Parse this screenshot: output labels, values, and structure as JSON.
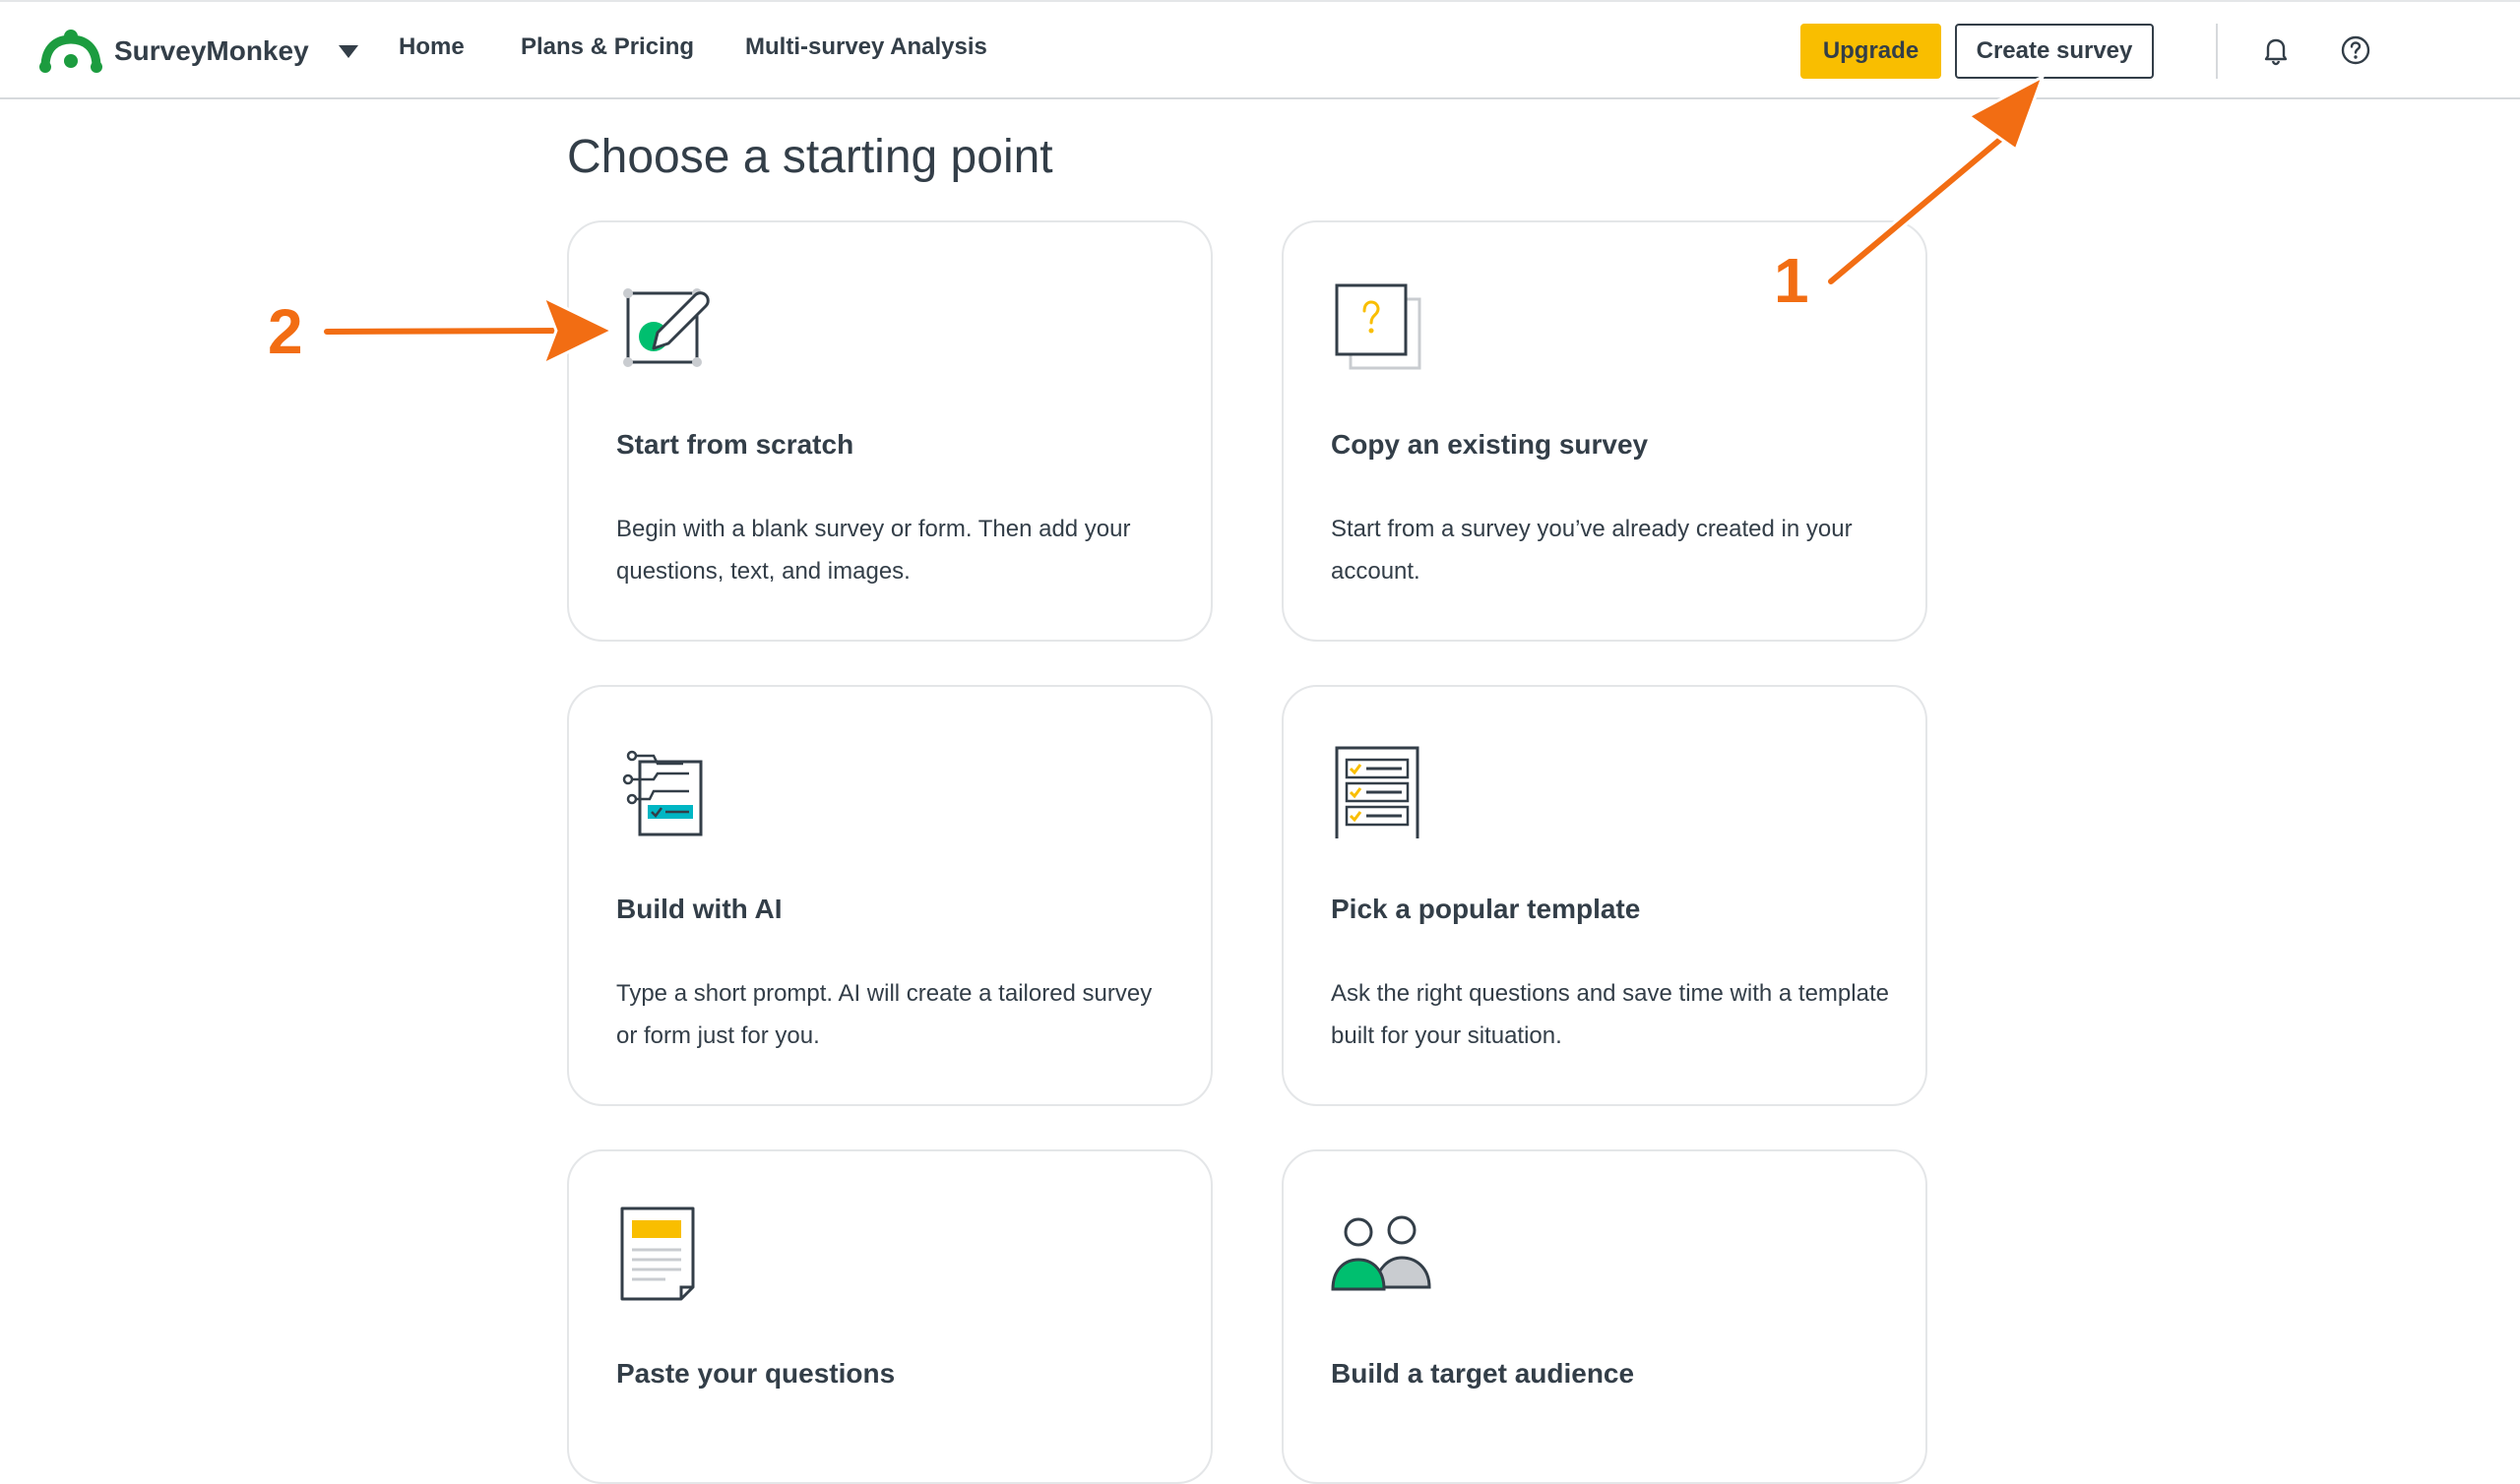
{
  "header": {
    "brand": "SurveyMonkey",
    "nav": [
      {
        "label": "Home"
      },
      {
        "label": "Plans & Pricing"
      },
      {
        "label": "Multi-survey Analysis"
      }
    ],
    "upgrade_label": "Upgrade",
    "create_label": "Create survey",
    "icons": [
      "bell-icon",
      "help-icon"
    ]
  },
  "main": {
    "title": "Choose a starting point",
    "cards": [
      {
        "title": "Start from scratch",
        "desc": "Begin with a blank survey or form. Then add your questions, text, and images.",
        "icon": "pencil-edit-icon"
      },
      {
        "title": "Copy an existing survey",
        "desc": "Start from a survey you’ve already created in your account.",
        "icon": "copy-question-icon"
      },
      {
        "title": "Build with AI",
        "desc": "Type a short prompt. AI will create a tailored survey or form just for you.",
        "icon": "ai-build-icon"
      },
      {
        "title": "Pick a popular template",
        "desc": "Ask the right questions and save time with a template built for your situation.",
        "icon": "checklist-template-icon"
      },
      {
        "title": "Paste your questions",
        "desc": "",
        "icon": "paste-document-icon"
      },
      {
        "title": "Build a target audience",
        "desc": "",
        "icon": "audience-people-icon"
      }
    ]
  },
  "annotations": [
    {
      "label": "1"
    },
    {
      "label": "2"
    }
  ],
  "colors": {
    "brand_green": "#00bf6f",
    "logo_green": "#1c9c3f",
    "upgrade_yellow": "#f9be00",
    "text": "#333e48",
    "annotation_orange": "#f26d13"
  }
}
